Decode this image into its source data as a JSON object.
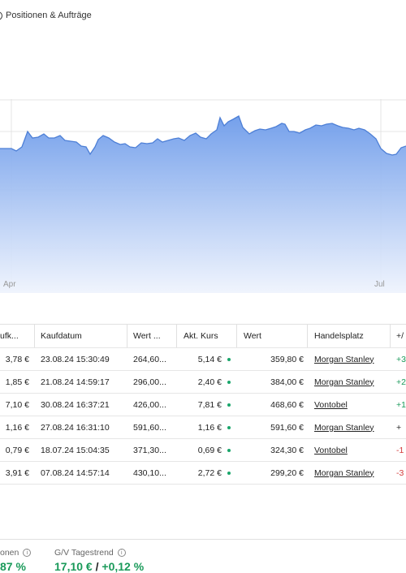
{
  "topbar": {
    "label": "Positionen & Aufträge"
  },
  "chart_data": {
    "type": "area",
    "x_ticks": [
      "Apr",
      "Jul"
    ],
    "color": "#5b8fe0",
    "points": [
      [
        0,
        183
      ],
      [
        14,
        183
      ],
      [
        20,
        186
      ],
      [
        27,
        181
      ],
      [
        34,
        162
      ],
      [
        40,
        170
      ],
      [
        47,
        169
      ],
      [
        54,
        165
      ],
      [
        60,
        170
      ],
      [
        67,
        170
      ],
      [
        74,
        167
      ],
      [
        80,
        173
      ],
      [
        87,
        174
      ],
      [
        94,
        175
      ],
      [
        100,
        180
      ],
      [
        106,
        181
      ],
      [
        111,
        190
      ],
      [
        117,
        181
      ],
      [
        121,
        172
      ],
      [
        127,
        167
      ],
      [
        134,
        170
      ],
      [
        141,
        175
      ],
      [
        148,
        178
      ],
      [
        154,
        177
      ],
      [
        160,
        181
      ],
      [
        167,
        182
      ],
      [
        174,
        176
      ],
      [
        181,
        177
      ],
      [
        188,
        176
      ],
      [
        194,
        171
      ],
      [
        200,
        175
      ],
      [
        207,
        173
      ],
      [
        214,
        171
      ],
      [
        220,
        170
      ],
      [
        227,
        173
      ],
      [
        234,
        167
      ],
      [
        241,
        164
      ],
      [
        247,
        169
      ],
      [
        254,
        171
      ],
      [
        260,
        165
      ],
      [
        267,
        160
      ],
      [
        271,
        145
      ],
      [
        276,
        155
      ],
      [
        281,
        150
      ],
      [
        287,
        147
      ],
      [
        294,
        143
      ],
      [
        299,
        157
      ],
      [
        307,
        165
      ],
      [
        314,
        161
      ],
      [
        320,
        159
      ],
      [
        327,
        160
      ],
      [
        334,
        158
      ],
      [
        340,
        156
      ],
      [
        347,
        152
      ],
      [
        351,
        153
      ],
      [
        356,
        162
      ],
      [
        362,
        162
      ],
      [
        369,
        164
      ],
      [
        376,
        160
      ],
      [
        382,
        158
      ],
      [
        389,
        154
      ],
      [
        396,
        155
      ],
      [
        402,
        153
      ],
      [
        409,
        152
      ],
      [
        416,
        155
      ],
      [
        422,
        157
      ],
      [
        429,
        158
      ],
      [
        436,
        160
      ],
      [
        442,
        158
      ],
      [
        449,
        160
      ],
      [
        456,
        165
      ],
      [
        463,
        171
      ],
      [
        469,
        183
      ],
      [
        476,
        189
      ],
      [
        483,
        191
      ],
      [
        488,
        190
      ],
      [
        494,
        182
      ],
      [
        500,
        180
      ]
    ]
  },
  "table": {
    "columns": [
      "ufk...",
      "Kaufdatum",
      "Wert ...",
      "Akt. Kurs",
      "Wert",
      "Handelsplatz",
      "+/"
    ],
    "rows": [
      {
        "kauf": "3,78 €",
        "date": "23.08.24 15:30:49",
        "wert1": "264,60...",
        "kurs": "5,14 €",
        "wert": "359,80 €",
        "platz": "Morgan Stanley",
        "gv": "+3",
        "gv_cls": "pos"
      },
      {
        "kauf": "1,85 €",
        "date": "21.08.24 14:59:17",
        "wert1": "296,00...",
        "kurs": "2,40 €",
        "wert": "384,00 €",
        "platz": "Morgan Stanley",
        "gv": "+2",
        "gv_cls": "pos"
      },
      {
        "kauf": "7,10 €",
        "date": "30.08.24 16:37:21",
        "wert1": "426,00...",
        "kurs": "7,81 €",
        "wert": "468,60 €",
        "platz": "Vontobel",
        "gv": "+1",
        "gv_cls": "pos"
      },
      {
        "kauf": "1,16 €",
        "date": "27.08.24 16:31:10",
        "wert1": "591,60...",
        "kurs": "1,16 €",
        "wert": "591,60 €",
        "platz": "Morgan Stanley",
        "gv": "+",
        "gv_cls": "neutral"
      },
      {
        "kauf": "0,79 €",
        "date": "18.07.24 15:04:35",
        "wert1": "371,30...",
        "kurs": "0,69 €",
        "wert": "324,30 €",
        "platz": "Vontobel",
        "gv": "-1",
        "gv_cls": "neg"
      },
      {
        "kauf": "3,91 €",
        "date": "07.08.24 14:57:14",
        "wert1": "430,10...",
        "kurs": "2,72 €",
        "wert": "299,20 €",
        "platz": "Morgan Stanley",
        "gv": "-3",
        "gv_cls": "neg"
      }
    ]
  },
  "footer": {
    "left_label": "onen",
    "left_value": "87 %",
    "trend_label": "G/V Tagestrend",
    "trend_abs": "17,10 €",
    "trend_sep": " / ",
    "trend_pct": "+0,12 %"
  }
}
